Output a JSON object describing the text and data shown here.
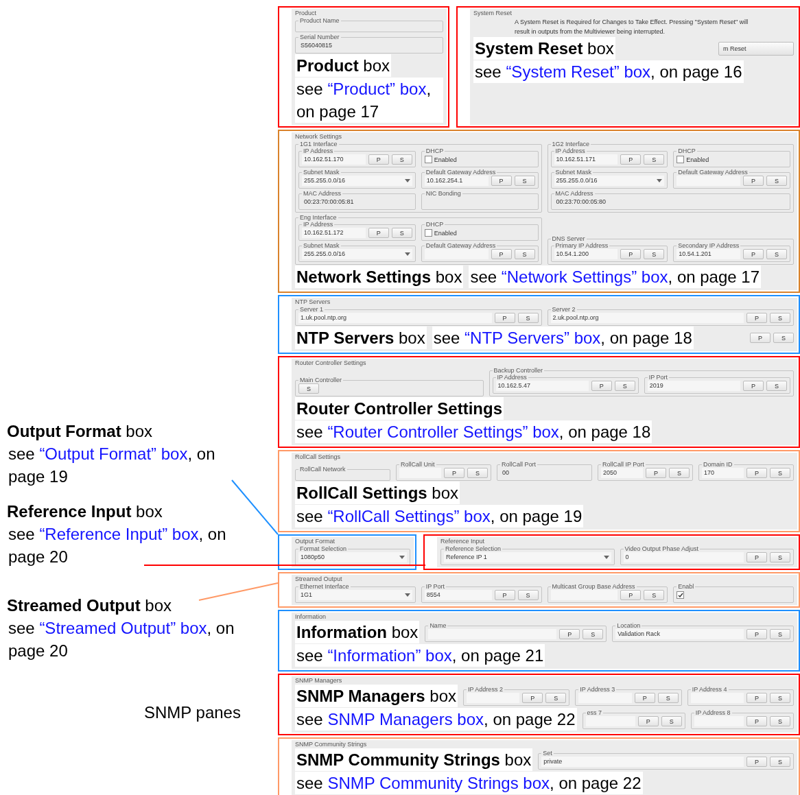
{
  "left_annotations": [
    {
      "heading": "**Output Format** box",
      "text_before": "see ",
      "link": "“Output Format” box",
      "text_after": ", on page 19",
      "color": "#1e90ff"
    },
    {
      "heading": "**Reference Input** box",
      "text_before": "see ",
      "link": "“Reference Input” box",
      "text_after": ", on page 20",
      "color": "#ff0000"
    },
    {
      "heading": "**Streamed Output** box",
      "text_before": "see ",
      "link": "“Streamed Output” box",
      "text_after": ", on page 20",
      "color": "#ff9966"
    }
  ],
  "note": "SNMP panes",
  "rows": [
    {
      "panels": [
        {
          "kind": "product",
          "title": "Product",
          "color": "#ff0000",
          "top": [
            {
              "kind": "box",
              "label": "Product Name"
            },
            {
              "kind": "readonly",
              "label": "Serial Number",
              "value": "S56040815"
            }
          ],
          "callout": {
            "kind": "stacked",
            "heading": "**Product** box",
            "text_before": "see ",
            "link": "“Product” box",
            "text_after": ", on page 17"
          }
        },
        {
          "kind": "system_reset",
          "title": "System Reset",
          "color": "#ff0000",
          "top": [
            {
              "kind": "para",
              "text": "A System Reset is Required for Changes to Take Effect. Pressing \"System Reset\" will result in outputs from the Multiviewer being interrupted."
            }
          ],
          "callout": {
            "kind": "stacked",
            "heading": "**System Reset** box",
            "text_before": "see ",
            "link": "“System Reset” box",
            "text_after": ", on page 16",
            "heading_side": [
              {
                "kind": "button",
                "label": "m Reset"
              }
            ]
          }
        }
      ]
    },
    {
      "panels": [
        {
          "kind": "network",
          "title": "Network Settings",
          "color": "#d9822b",
          "top": [
            {
              "kind": "box",
              "label": "1G1 Interface",
              "items": [
                {
                  "kind": "text",
                  "label": "IP Address",
                  "value": "10.162.51.170",
                  "buttons": [
                    "P",
                    "S"
                  ]
                },
                {
                  "kind": "check",
                  "label": "DHCP",
                  "option": "Enabled",
                  "checked": false
                },
                {
                  "kind": "select",
                  "label": "Subnet Mask",
                  "value": "255.255.0.0/16"
                },
                {
                  "kind": "text",
                  "label": "Default Gateway Address",
                  "value": "10.162.254.1",
                  "buttons": [
                    "P",
                    "S"
                  ]
                },
                {
                  "kind": "readonly",
                  "label": "MAC Address",
                  "value": "00:23:70:00:05:81"
                },
                {
                  "kind": "readonly",
                  "label": "NIC Bonding"
                }
              ]
            },
            {
              "kind": "box",
              "label": "1G2 Interface",
              "items": [
                {
                  "kind": "text",
                  "label": "IP Address",
                  "value": "10.162.51.171",
                  "buttons": [
                    "P",
                    "S"
                  ]
                },
                {
                  "kind": "check",
                  "label": "DHCP",
                  "option": "Enabled",
                  "checked": false
                },
                {
                  "kind": "select",
                  "label": "Subnet Mask",
                  "value": "255.255.0.0/16"
                },
                {
                  "kind": "text",
                  "label": "Default Gateway Address",
                  "buttons": [
                    "P",
                    "S"
                  ]
                },
                {
                  "kind": "readonly",
                  "label": "MAC Address",
                  "value": "00:23:70:00:05:80"
                }
              ]
            },
            {
              "kind": "box",
              "label": "Eng Interface",
              "items": [
                {
                  "kind": "text",
                  "label": "IP Address",
                  "value": "10.162.51.172",
                  "buttons": [
                    "P",
                    "S"
                  ]
                },
                {
                  "kind": "check",
                  "label": "DHCP",
                  "option": "Enabled",
                  "checked": false
                },
                {
                  "kind": "select",
                  "label": "Subnet Mask",
                  "value": "255.255.0.0/16"
                },
                {
                  "kind": "text",
                  "label": "Default Gateway Address",
                  "buttons": [
                    "P",
                    "S"
                  ]
                }
              ]
            },
            {
              "kind": "box",
              "label": "DNS Server",
              "items": [
                {
                  "kind": "text",
                  "label": "Primary IP Address",
                  "value": "10.54.1.200",
                  "buttons": [
                    "P",
                    "S"
                  ]
                },
                {
                  "kind": "text",
                  "label": "Secondary IP Address",
                  "value": "10.54.1.201",
                  "buttons": [
                    "P",
                    "S"
                  ]
                }
              ]
            }
          ],
          "callout": {
            "kind": "inline",
            "heading": "**Network Settings** box",
            "text_before": "see ",
            "link": "“Network Settings” box",
            "text_after": ", on page 17"
          }
        }
      ]
    },
    {
      "panels": [
        {
          "kind": "ntp",
          "title": "NTP Servers",
          "color": "#1e90ff",
          "top": [
            {
              "kind": "text",
              "label": "Server 1",
              "value": "1.uk.pool.ntp.org",
              "buttons": [
                "P",
                "S"
              ]
            },
            {
              "kind": "text",
              "label": "Server 2",
              "value": "2.uk.pool.ntp.org",
              "buttons": [
                "P",
                "S"
              ]
            }
          ],
          "callout": {
            "kind": "inline",
            "heading": "**NTP Servers** box",
            "text_before": "see ",
            "link": "“NTP Servers” box",
            "text_after": ", on page 18",
            "heading_side": [
              {
                "kind": "buttons",
                "buttons": [
                  "P",
                  "S"
                ]
              }
            ]
          }
        }
      ]
    },
    {
      "panels": [
        {
          "kind": "router",
          "title": "Router Controller Settings",
          "color": "#ff0000",
          "top": [
            {
              "kind": "box",
              "label": "Main Controller",
              "items": [
                {
                  "kind": "buttons",
                  "buttons": [
                    "S"
                  ]
                }
              ]
            },
            {
              "kind": "box",
              "label": "Backup Controller",
              "items": [
                {
                  "kind": "text",
                  "label": "IP Address",
                  "value": "10.162.5.47",
                  "buttons": [
                    "P",
                    "S"
                  ]
                },
                {
                  "kind": "text",
                  "label": "IP Port",
                  "value": "2019",
                  "buttons": [
                    "P",
                    "S"
                  ]
                }
              ]
            }
          ],
          "callout": {
            "kind": "stacked",
            "heading": "**Router Controller Settings**",
            "text_before": "see ",
            "link": "“Router Controller Settings” box",
            "text_after": ", on page 18"
          }
        }
      ]
    },
    {
      "panels": [
        {
          "kind": "rollcall",
          "title": "RollCall Settings",
          "color": "#ff9966",
          "top": [
            {
              "kind": "box",
              "label": "RollCall Network"
            },
            {
              "kind": "text",
              "label": "RollCall Unit",
              "buttons": [
                "P",
                "S"
              ]
            },
            {
              "kind": "readonly",
              "label": "RollCall Port",
              "value": "00"
            },
            {
              "kind": "text",
              "label": "RollCall IP Port",
              "value": "2050",
              "buttons": [
                "P",
                "S"
              ]
            },
            {
              "kind": "text",
              "label": "Domain ID",
              "value": "170",
              "buttons": [
                "P",
                "S"
              ]
            }
          ],
          "callout": {
            "kind": "stacked",
            "heading": "**RollCall Settings** box",
            "text_before": "see ",
            "link": "“RollCall Settings” box",
            "text_after": ", on page 19"
          }
        }
      ]
    },
    {
      "panels": [
        {
          "kind": "output_format",
          "title": "Output Format",
          "color": "#1e90ff",
          "top": [
            {
              "kind": "select",
              "label": "Format Selection",
              "value": "1080p50"
            }
          ]
        },
        {
          "kind": "reference_input",
          "title": "Reference Input",
          "color": "#ff0000",
          "top": [
            {
              "kind": "select",
              "label": "Reference Selection",
              "value": "Reference IP 1"
            },
            {
              "kind": "text",
              "label": "Video Output Phase Adjust",
              "value": "0",
              "buttons": [
                "P",
                "S"
              ]
            }
          ]
        }
      ]
    },
    {
      "panels": [
        {
          "kind": "streamed",
          "title": "Streamed Output",
          "color": "#ff9966",
          "top": [
            {
              "kind": "select",
              "label": "Ethernet Interface",
              "value": "1G1"
            },
            {
              "kind": "text",
              "label": "IP Port",
              "value": "8554",
              "buttons": [
                "P",
                "S"
              ]
            },
            {
              "kind": "text",
              "label": "Multicast Group Base Address",
              "buttons": [
                "P",
                "S"
              ]
            },
            {
              "kind": "check",
              "label": "Enabl",
              "checked": true
            }
          ]
        }
      ]
    },
    {
      "panels": [
        {
          "kind": "information",
          "title": "Information",
          "color": "#1e90ff",
          "callout": {
            "kind": "stacked",
            "heading": "**Information** box",
            "text_before": "see ",
            "link": "“Information” box",
            "text_after": ", on page 21",
            "heading_side": [
              {
                "kind": "text",
                "label": "Name",
                "buttons": [
                  "P",
                  "S"
                ]
              },
              {
                "kind": "text",
                "label": "Location",
                "value": "Validation Rack",
                "buttons": [
                  "P",
                  "S"
                ]
              }
            ]
          }
        }
      ]
    },
    {
      "panels": [
        {
          "kind": "snmp_managers",
          "title": "SNMP Managers",
          "color": "#ff0000",
          "callout": {
            "kind": "stacked",
            "heading": "**SNMP Managers** box",
            "text_before": "see ",
            "link": "SNMP Managers box",
            "text_after": ", on page 22",
            "heading_side": [
              {
                "kind": "text",
                "label": "IP Address 2",
                "buttons": [
                  "P",
                  "S"
                ]
              },
              {
                "kind": "text",
                "label": "IP Address 3",
                "buttons": [
                  "P",
                  "S"
                ]
              },
              {
                "kind": "text",
                "label": "IP Address 4",
                "buttons": [
                  "P",
                  "S"
                ]
              }
            ],
            "see_side": [
              {
                "kind": "text",
                "label": "ess 7",
                "buttons": [
                  "P",
                  "S"
                ]
              },
              {
                "kind": "text",
                "label": "IP Address 8",
                "buttons": [
                  "P",
                  "S"
                ]
              }
            ]
          }
        }
      ]
    },
    {
      "panels": [
        {
          "kind": "snmp_community",
          "title": "SNMP Community Strings",
          "color": "#ff9966",
          "callout": {
            "kind": "stacked",
            "heading": "**SNMP Community Strings** box",
            "text_before": "see ",
            "link": "SNMP Community Strings box",
            "text_after": ", on page 22",
            "heading_side": [
              {
                "kind": "text",
                "label": "Set",
                "value": "private",
                "buttons": [
                  "P",
                  "S"
                ]
              }
            ]
          }
        }
      ]
    }
  ]
}
